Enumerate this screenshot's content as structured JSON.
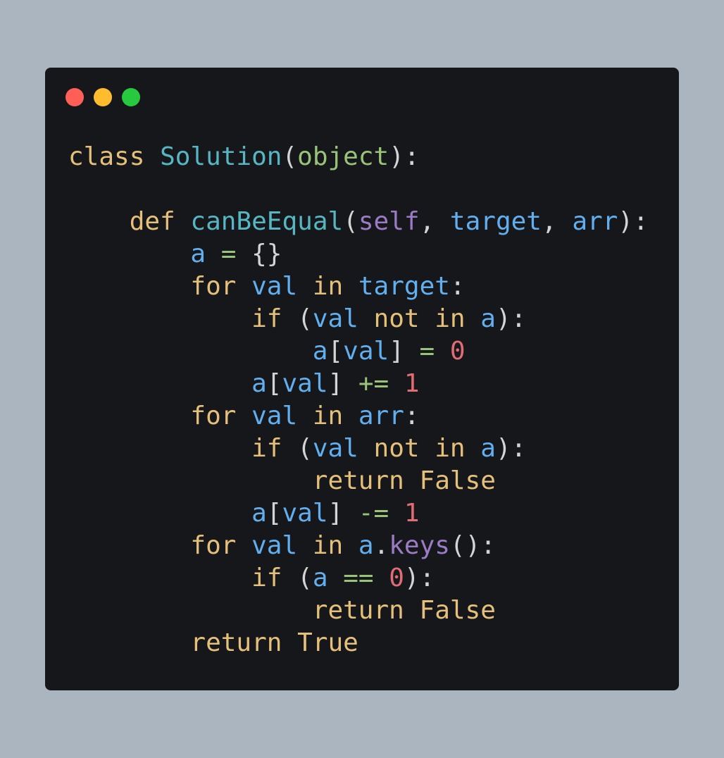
{
  "colors": {
    "background": "#abb5bf",
    "editor_bg": "#16171a",
    "keyword": "#e5c07b",
    "function": "#56b6c2",
    "identifier": "#61afef",
    "builtin": "#98c379",
    "self": "#9b7cc4",
    "operator": "#98c379",
    "number": "#e06c75",
    "punctuation": "#d4d4d4",
    "control_close": "#ff5f56",
    "control_minimize": "#ffbd2e",
    "control_maximize": "#27c93f"
  },
  "window_controls": [
    {
      "name": "close-button",
      "color": "#ff5f56"
    },
    {
      "name": "minimize-button",
      "color": "#ffbd2e"
    },
    {
      "name": "maximize-button",
      "color": "#27c93f"
    }
  ],
  "code_lines": [
    [
      {
        "t": "class",
        "c": "keyword"
      },
      {
        "t": " ",
        "c": "punctuation"
      },
      {
        "t": "Solution",
        "c": "function"
      },
      {
        "t": "(",
        "c": "punctuation"
      },
      {
        "t": "object",
        "c": "builtin"
      },
      {
        "t": "):",
        "c": "punctuation"
      }
    ],
    [],
    [
      {
        "t": "    ",
        "c": "punctuation"
      },
      {
        "t": "def",
        "c": "keyword"
      },
      {
        "t": " ",
        "c": "punctuation"
      },
      {
        "t": "canBeEqual",
        "c": "function"
      },
      {
        "t": "(",
        "c": "punctuation"
      },
      {
        "t": "self",
        "c": "self"
      },
      {
        "t": ", ",
        "c": "punctuation"
      },
      {
        "t": "target",
        "c": "identifier"
      },
      {
        "t": ", ",
        "c": "punctuation"
      },
      {
        "t": "arr",
        "c": "identifier"
      },
      {
        "t": "):",
        "c": "punctuation"
      }
    ],
    [
      {
        "t": "        ",
        "c": "punctuation"
      },
      {
        "t": "a",
        "c": "identifier"
      },
      {
        "t": " ",
        "c": "punctuation"
      },
      {
        "t": "=",
        "c": "operator"
      },
      {
        "t": " {}",
        "c": "punctuation"
      }
    ],
    [
      {
        "t": "        ",
        "c": "punctuation"
      },
      {
        "t": "for",
        "c": "keyword"
      },
      {
        "t": " ",
        "c": "punctuation"
      },
      {
        "t": "val",
        "c": "identifier"
      },
      {
        "t": " ",
        "c": "punctuation"
      },
      {
        "t": "in",
        "c": "keyword"
      },
      {
        "t": " ",
        "c": "punctuation"
      },
      {
        "t": "target",
        "c": "identifier"
      },
      {
        "t": ":",
        "c": "punctuation"
      }
    ],
    [
      {
        "t": "            ",
        "c": "punctuation"
      },
      {
        "t": "if",
        "c": "keyword"
      },
      {
        "t": " (",
        "c": "punctuation"
      },
      {
        "t": "val",
        "c": "identifier"
      },
      {
        "t": " ",
        "c": "punctuation"
      },
      {
        "t": "not",
        "c": "keyword"
      },
      {
        "t": " ",
        "c": "punctuation"
      },
      {
        "t": "in",
        "c": "keyword"
      },
      {
        "t": " ",
        "c": "punctuation"
      },
      {
        "t": "a",
        "c": "identifier"
      },
      {
        "t": "):",
        "c": "punctuation"
      }
    ],
    [
      {
        "t": "                ",
        "c": "punctuation"
      },
      {
        "t": "a",
        "c": "identifier"
      },
      {
        "t": "[",
        "c": "punctuation"
      },
      {
        "t": "val",
        "c": "identifier"
      },
      {
        "t": "] ",
        "c": "punctuation"
      },
      {
        "t": "=",
        "c": "operator"
      },
      {
        "t": " ",
        "c": "punctuation"
      },
      {
        "t": "0",
        "c": "number"
      }
    ],
    [
      {
        "t": "            ",
        "c": "punctuation"
      },
      {
        "t": "a",
        "c": "identifier"
      },
      {
        "t": "[",
        "c": "punctuation"
      },
      {
        "t": "val",
        "c": "identifier"
      },
      {
        "t": "] ",
        "c": "punctuation"
      },
      {
        "t": "+=",
        "c": "operator"
      },
      {
        "t": " ",
        "c": "punctuation"
      },
      {
        "t": "1",
        "c": "number"
      }
    ],
    [
      {
        "t": "        ",
        "c": "punctuation"
      },
      {
        "t": "for",
        "c": "keyword"
      },
      {
        "t": " ",
        "c": "punctuation"
      },
      {
        "t": "val",
        "c": "identifier"
      },
      {
        "t": " ",
        "c": "punctuation"
      },
      {
        "t": "in",
        "c": "keyword"
      },
      {
        "t": " ",
        "c": "punctuation"
      },
      {
        "t": "arr",
        "c": "identifier"
      },
      {
        "t": ":",
        "c": "punctuation"
      }
    ],
    [
      {
        "t": "            ",
        "c": "punctuation"
      },
      {
        "t": "if",
        "c": "keyword"
      },
      {
        "t": " (",
        "c": "punctuation"
      },
      {
        "t": "val",
        "c": "identifier"
      },
      {
        "t": " ",
        "c": "punctuation"
      },
      {
        "t": "not",
        "c": "keyword"
      },
      {
        "t": " ",
        "c": "punctuation"
      },
      {
        "t": "in",
        "c": "keyword"
      },
      {
        "t": " ",
        "c": "punctuation"
      },
      {
        "t": "a",
        "c": "identifier"
      },
      {
        "t": "):",
        "c": "punctuation"
      }
    ],
    [
      {
        "t": "                ",
        "c": "punctuation"
      },
      {
        "t": "return",
        "c": "keyword"
      },
      {
        "t": " ",
        "c": "punctuation"
      },
      {
        "t": "False",
        "c": "keyword"
      }
    ],
    [
      {
        "t": "            ",
        "c": "punctuation"
      },
      {
        "t": "a",
        "c": "identifier"
      },
      {
        "t": "[",
        "c": "punctuation"
      },
      {
        "t": "val",
        "c": "identifier"
      },
      {
        "t": "] ",
        "c": "punctuation"
      },
      {
        "t": "-=",
        "c": "operator"
      },
      {
        "t": " ",
        "c": "punctuation"
      },
      {
        "t": "1",
        "c": "number"
      }
    ],
    [
      {
        "t": "        ",
        "c": "punctuation"
      },
      {
        "t": "for",
        "c": "keyword"
      },
      {
        "t": " ",
        "c": "punctuation"
      },
      {
        "t": "val",
        "c": "identifier"
      },
      {
        "t": " ",
        "c": "punctuation"
      },
      {
        "t": "in",
        "c": "keyword"
      },
      {
        "t": " ",
        "c": "punctuation"
      },
      {
        "t": "a",
        "c": "identifier"
      },
      {
        "t": ".",
        "c": "punctuation"
      },
      {
        "t": "keys",
        "c": "self"
      },
      {
        "t": "():",
        "c": "punctuation"
      }
    ],
    [
      {
        "t": "            ",
        "c": "punctuation"
      },
      {
        "t": "if",
        "c": "keyword"
      },
      {
        "t": " (",
        "c": "punctuation"
      },
      {
        "t": "a",
        "c": "identifier"
      },
      {
        "t": " ",
        "c": "punctuation"
      },
      {
        "t": "==",
        "c": "operator"
      },
      {
        "t": " ",
        "c": "punctuation"
      },
      {
        "t": "0",
        "c": "number"
      },
      {
        "t": "):",
        "c": "punctuation"
      }
    ],
    [
      {
        "t": "                ",
        "c": "punctuation"
      },
      {
        "t": "return",
        "c": "keyword"
      },
      {
        "t": " ",
        "c": "punctuation"
      },
      {
        "t": "False",
        "c": "keyword"
      }
    ],
    [
      {
        "t": "        ",
        "c": "punctuation"
      },
      {
        "t": "return",
        "c": "keyword"
      },
      {
        "t": " ",
        "c": "punctuation"
      },
      {
        "t": "True",
        "c": "keyword"
      }
    ]
  ]
}
